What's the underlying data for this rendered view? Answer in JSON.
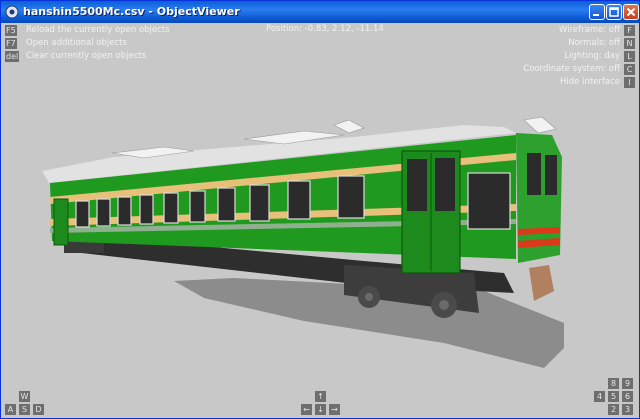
{
  "window": {
    "title": "hanshin5500Mc.csv - ObjectViewer"
  },
  "titlebar_buttons": [
    "minimize",
    "maximize",
    "close"
  ],
  "overlay": {
    "left_commands": [
      {
        "key": "F5",
        "label": "Reload the currently open objects"
      },
      {
        "key": "F7",
        "label": "Open additional objects"
      },
      {
        "key": "del",
        "label": "Clear currently open objects"
      }
    ],
    "position": "Position: -0.83, 2.12, -11.14",
    "right_toggles": [
      {
        "label": "Wireframe: off",
        "key": "F"
      },
      {
        "label": "Normals: off",
        "key": "N"
      },
      {
        "label": "Lighting: day",
        "key": "L"
      },
      {
        "label": "Coordinate system: off",
        "key": "C"
      },
      {
        "label": "Hide interface",
        "key": "I"
      }
    ],
    "bottom_left_keys": {
      "top": "W",
      "bottom": [
        "A",
        "S",
        "D"
      ]
    },
    "bottom_center_keys": {
      "top": "↑",
      "bottom": [
        "←",
        "↓",
        "→"
      ]
    },
    "bottom_right_keys": {
      "top": [
        "8",
        "9"
      ],
      "bottom": [
        "4",
        "5",
        "6",
        "2",
        "3"
      ]
    }
  },
  "colors": {
    "background": "#c8c8c8",
    "overlay_key_bg": "#6e6e6e",
    "train_body": "#1f9a1f",
    "train_stripe": "#e8c07a",
    "train_roof": "#e0e0e0"
  }
}
